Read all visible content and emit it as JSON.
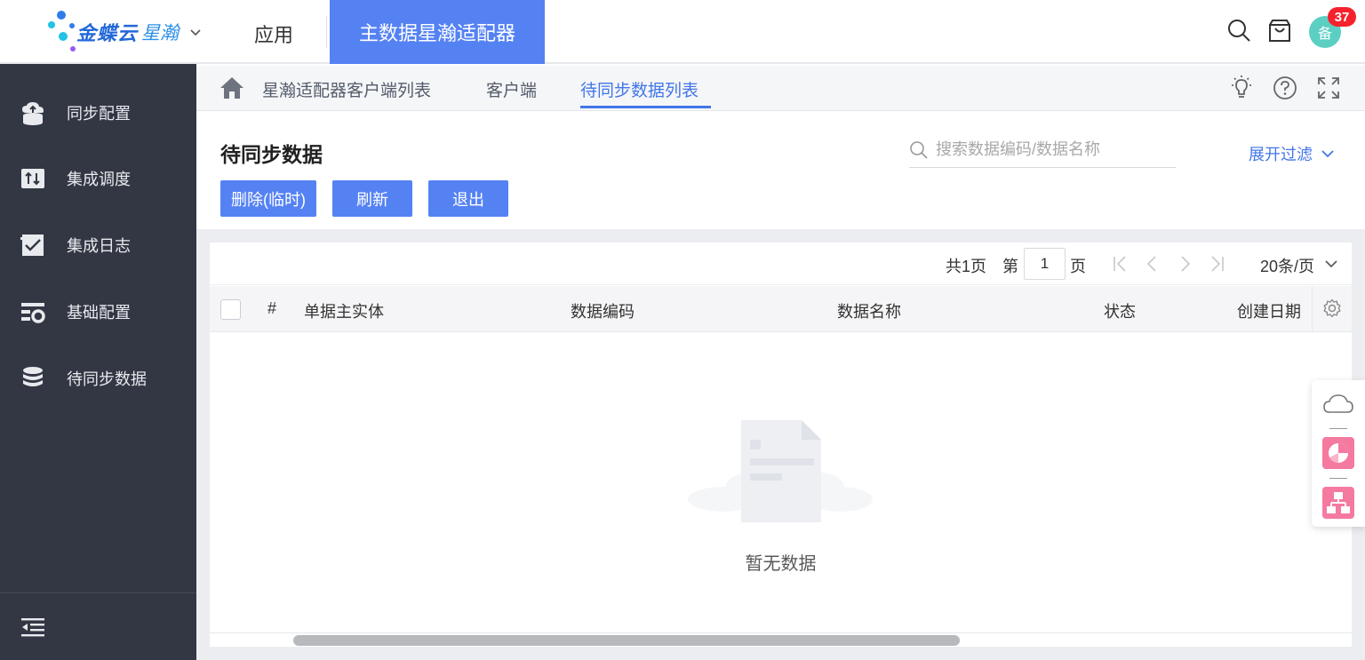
{
  "header": {
    "logo_text": "金蝶云",
    "logo_sub": "星瀚",
    "app_label": "应用",
    "active_app": "主数据星瀚适配器",
    "avatar_text": "备",
    "badge_count": "37"
  },
  "sidebar": {
    "items": [
      {
        "label": "同步配置",
        "icon": "cloud-sync-icon"
      },
      {
        "label": "集成调度",
        "icon": "schedule-icon"
      },
      {
        "label": "集成日志",
        "icon": "log-icon"
      },
      {
        "label": "基础配置",
        "icon": "config-icon"
      },
      {
        "label": "待同步数据",
        "icon": "database-icon"
      }
    ]
  },
  "tabs": [
    {
      "label": "星瀚适配器客户端列表"
    },
    {
      "label": "客户端"
    },
    {
      "label": "待同步数据列表"
    }
  ],
  "page": {
    "title": "待同步数据",
    "search_placeholder": "搜索数据编码/数据名称",
    "filter_label": "展开过滤",
    "buttons": {
      "delete": "删除(临时)",
      "refresh": "刷新",
      "exit": "退出"
    }
  },
  "pager": {
    "total": "共1页",
    "page_prefix": "第",
    "current_page": "1",
    "page_suffix": "页",
    "page_size": "20条/页"
  },
  "table": {
    "columns": [
      "#",
      "单据主实体",
      "数据编码",
      "数据名称",
      "状态",
      "创建日期"
    ],
    "empty_text": "暂无数据"
  },
  "colors": {
    "accent": "#5582f3",
    "link": "#4276e8",
    "sidebar_bg": "#333744",
    "badge": "#f5222d",
    "avatar": "#5ccfc3"
  }
}
